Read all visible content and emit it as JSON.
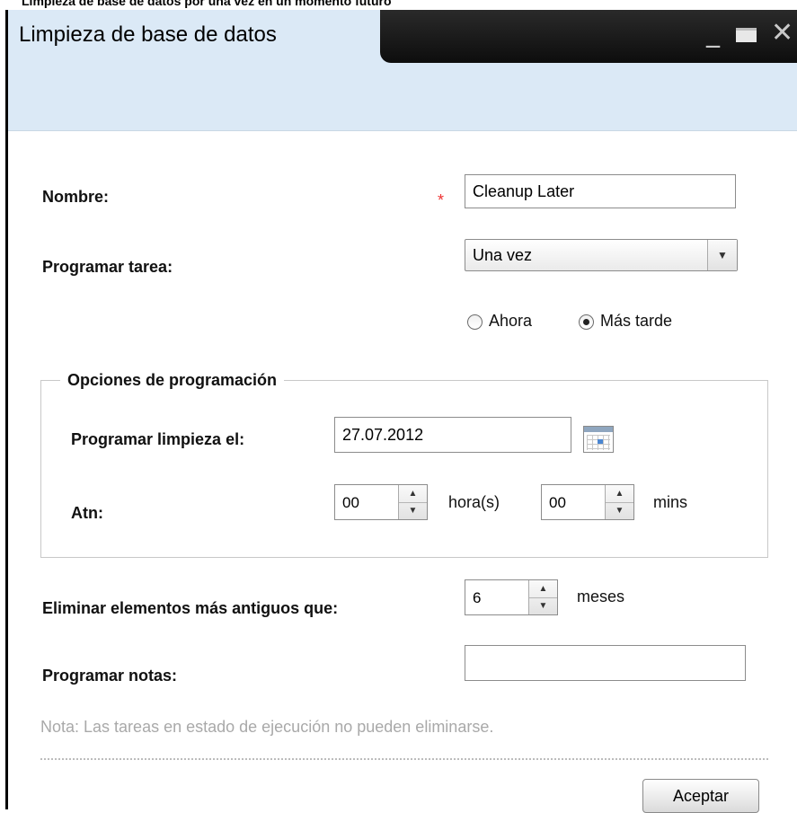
{
  "caption": "Limpieza de base de datos por una vez en un momento futuro",
  "window": {
    "title": "Limpieza de base de datos",
    "controls": {
      "minimize": "_",
      "close": "✕"
    }
  },
  "form": {
    "name_label": "Nombre:",
    "required_mark": "*",
    "name_value": "Cleanup Later",
    "schedule_label": "Programar tarea:",
    "schedule_value": "Una vez",
    "schedule_arrow": "▼",
    "radio_now": "Ahora",
    "radio_later": "Más tarde",
    "radio_selected": "Más tarde"
  },
  "schedule_options": {
    "legend": "Opciones de programación",
    "date_label": "Programar limpieza el:",
    "date_value": "27.07.2012",
    "time_label": "Atn:",
    "hours_value": "00",
    "hours_unit": "hora(s)",
    "mins_value": "00",
    "mins_unit": "mins"
  },
  "purge": {
    "label": "Eliminar elementos más antiguos que:",
    "value": "6",
    "unit": "meses"
  },
  "notes": {
    "label": "Programar notas:",
    "value": ""
  },
  "note_text": "Nota: Las tareas en estado de ejecución no pueden eliminarse.",
  "spin_icons": {
    "up": "▲",
    "down": "▼"
  },
  "accept_button": "Aceptar"
}
